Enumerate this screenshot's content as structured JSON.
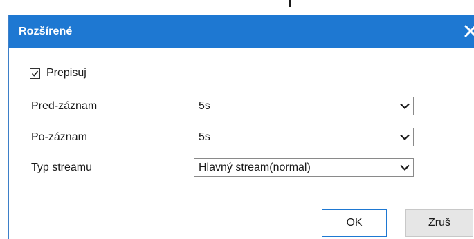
{
  "dialog": {
    "title": "Rozšírené",
    "close_icon": "close-icon",
    "colors": {
      "titlebar": "#1e78d2",
      "title_text": "#ffffff",
      "ok_border": "#1e78d2",
      "cancel_bg": "#e6e6e6"
    }
  },
  "overwrite": {
    "label": "Prepisuj",
    "checked": true
  },
  "fields": {
    "pre_record": {
      "label": "Pred-záznam",
      "value": "5s"
    },
    "post_record": {
      "label": "Po-záznam",
      "value": "5s"
    },
    "stream_type": {
      "label": "Typ streamu",
      "value": "Hlavný stream(normal)"
    }
  },
  "buttons": {
    "ok": "OK",
    "cancel": "Zruš"
  }
}
